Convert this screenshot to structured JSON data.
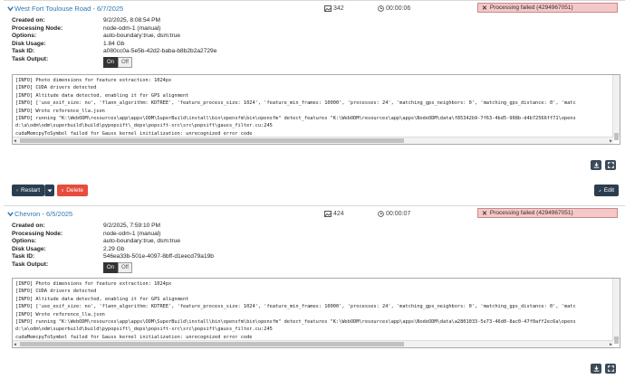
{
  "tasks": [
    {
      "title": "West Fort Toulouse Road - 6/7/2025",
      "images": "342",
      "duration": "00:00:06",
      "status": "Processing failed (4294967051)",
      "status_color": "#f4c8c8",
      "properties": [
        {
          "label": "Created on:",
          "value": "9/2/2025, 8:08:54 PM"
        },
        {
          "label": "Processing Node:",
          "value": "node-odm-1 (manual)"
        },
        {
          "label": "Options:",
          "value": "auto-boundary:true, dsm:true"
        },
        {
          "label": "Disk Usage:",
          "value": "1.84 Gb"
        },
        {
          "label": "Task ID:",
          "value": "a080cc0a-5e5b-42d2-baba-b8b2b2a2729e"
        },
        {
          "label": "Task Output:",
          "value": ""
        }
      ],
      "toggle": {
        "on": "On",
        "off": "Off"
      },
      "console_lines": [
        "[INFO]    Photo dimensions for feature extraction: 1024px",
        "[INFO]    CUDA drivers detected",
        "[INFO]    Altitude data detected, enabling it for GPS alignment",
        "[INFO]    ['use_exif_size: no', 'flann_algorithm: KDTREE', 'feature_process_size: 1024', 'feature_min_frames: 10000', 'processes: 24', 'matching_gps_neighbors: 0', 'matching_gps_distance: 0', 'matc",
        "[INFO]    Wrote reference_lla.json",
        "[INFO]    running \"K:\\WebODM\\resources\\app\\apps\\ODM\\SuperBuild\\install\\bin\\opensfm\\bin\\opensfm\" detect_features \"K:\\WebODM\\resources\\app\\apps\\NodeODM\\data\\f85342b9-7f63-4bd5-998b-d4b72566ff71\\opens",
        "d:\\a\\odm\\odm\\superbuild\\build\\pypopsift\\_deps\\popsift-src\\src\\popsift\\gauss_filter.cu:245",
        "cudaMemcpyToSymbol failed for Gauss kernel initialization: unrecognized error code"
      ],
      "restart_label": "Restart",
      "delete_label": "Delete",
      "edit_label": "Edit"
    },
    {
      "title": "Chevron - 6/5/2025",
      "images": "424",
      "duration": "00:00:07",
      "status": "Processing failed (4294967051)",
      "status_color": "#f4c8c8",
      "properties": [
        {
          "label": "Created on:",
          "value": "9/2/2025, 7:59:10 PM"
        },
        {
          "label": "Processing Node:",
          "value": "node-odm-1 (manual)"
        },
        {
          "label": "Options:",
          "value": "auto-boundary:true, dsm:true"
        },
        {
          "label": "Disk Usage:",
          "value": "2.29 Gb"
        },
        {
          "label": "Task ID:",
          "value": "546ea33b-501e-4097-8bff-d1eecd79a19b"
        },
        {
          "label": "Task Output:",
          "value": ""
        }
      ],
      "toggle": {
        "on": "On",
        "off": "Off"
      },
      "console_lines": [
        "[INFO]    Photo dimensions for feature extraction: 1024px",
        "[INFO]    CUDA drivers detected",
        "[INFO]    Altitude data detected, enabling it for GPS alignment",
        "[INFO]    ['use_exif_size: no', 'flann_algorithm: KDTREE', 'feature_process_size: 1024', 'feature_min_frames: 10000', 'processes: 24', 'matching_gps_neighbors: 0', 'matching_gps_distance: 0', 'matc",
        "[INFO]    Wrote reference_lla.json",
        "[INFO]    running \"K:\\WebODM\\resources\\app\\apps\\ODM\\SuperBuild\\install\\bin\\opensfm\\bin\\opensfm\" detect_features \"K:\\WebODM\\resources\\app\\apps\\NodeODM\\data\\a2801033-5e73-46d0-8ac0-47f0aff2ec6a\\opens",
        "d:\\a\\odm\\odm\\superbuild\\build\\pypopsift\\_deps\\popsift-src\\src\\popsift\\gauss_filter.cu:245",
        "cudaMemcpyToSymbol failed for Gauss kernel initialization: unrecognized error code"
      ]
    }
  ]
}
